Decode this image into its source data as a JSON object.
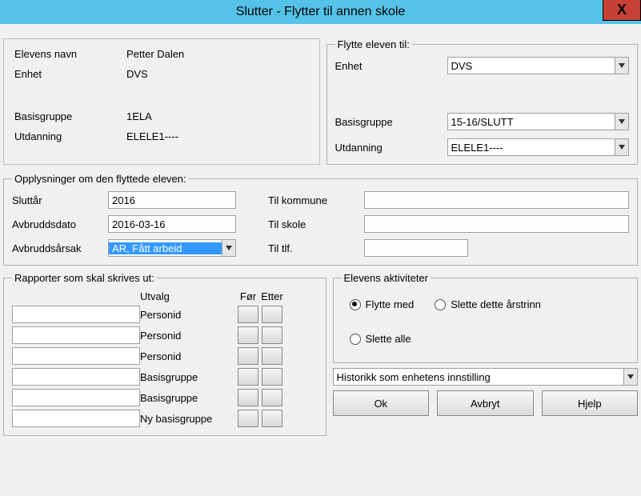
{
  "titlebar": {
    "title": "Slutter - Flytter til annen skole",
    "close": "X"
  },
  "student": {
    "name_label": "Elevens navn",
    "name_value": "Petter Dalen",
    "enhet_label": "Enhet",
    "enhet_value": "DVS",
    "basisgruppe_label": "Basisgruppe",
    "basisgruppe_value": "1ELA",
    "utdanning_label": "Utdanning",
    "utdanning_value": "ELELE1----"
  },
  "move": {
    "legend": "Flytte eleven til:",
    "enhet_label": "Enhet",
    "enhet_value": "DVS",
    "basisgruppe_label": "Basisgruppe",
    "basisgruppe_value": "15-16/SLUTT",
    "utdanning_label": "Utdanning",
    "utdanning_value": "ELELE1----"
  },
  "info": {
    "legend": "Opplysninger om den flyttede eleven:",
    "sluttar_label": "Sluttår",
    "sluttar_value": "2016",
    "avbruddsdato_label": "Avbruddsdato",
    "avbruddsdato_value": "2016-03-16",
    "avbruddsarsak_label": "Avbruddsårsak",
    "avbruddsarsak_value": "AR, Fått arbeid",
    "til_kommune_label": "Til kommune",
    "til_kommune_value": "",
    "til_skole_label": "Til skole",
    "til_skole_value": "",
    "til_tlf_label": "Til tlf.",
    "til_tlf_value": ""
  },
  "reports": {
    "legend": "Rapporter som skal skrives ut:",
    "utvalg_hdr": "Utvalg",
    "for_hdr": "Før",
    "etter_hdr": "Etter",
    "rows": [
      {
        "label": "Personid"
      },
      {
        "label": "Personid"
      },
      {
        "label": "Personid"
      },
      {
        "label": "Basisgruppe"
      },
      {
        "label": "Basisgruppe"
      },
      {
        "label": "Ny basisgruppe"
      }
    ]
  },
  "activities": {
    "legend": "Elevens aktiviteter",
    "flytte_med": "Flytte med",
    "slette_arstrinn": "Slette dette årstrinn",
    "slette_alle": "Slette alle",
    "selected": "flytte_med"
  },
  "history_combo": "Historikk som enhetens innstilling",
  "buttons": {
    "ok": "Ok",
    "avbryt": "Avbryt",
    "hjelp": "Hjelp"
  }
}
